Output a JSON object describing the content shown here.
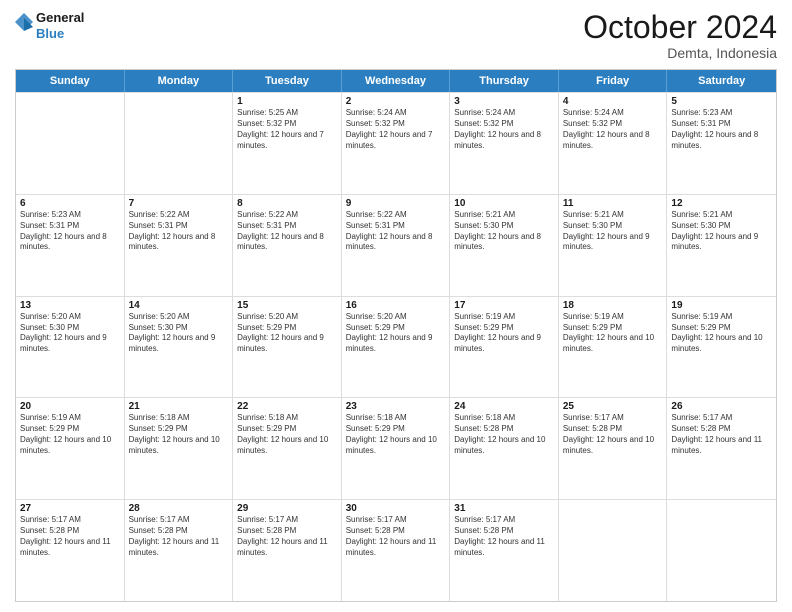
{
  "header": {
    "logo_line1": "General",
    "logo_line2": "Blue",
    "month_title": "October 2024",
    "location": "Demta, Indonesia"
  },
  "days_of_week": [
    "Sunday",
    "Monday",
    "Tuesday",
    "Wednesday",
    "Thursday",
    "Friday",
    "Saturday"
  ],
  "weeks": [
    [
      {
        "day": "",
        "sunrise": "",
        "sunset": "",
        "daylight": ""
      },
      {
        "day": "",
        "sunrise": "",
        "sunset": "",
        "daylight": ""
      },
      {
        "day": "1",
        "sunrise": "Sunrise: 5:25 AM",
        "sunset": "Sunset: 5:32 PM",
        "daylight": "Daylight: 12 hours and 7 minutes."
      },
      {
        "day": "2",
        "sunrise": "Sunrise: 5:24 AM",
        "sunset": "Sunset: 5:32 PM",
        "daylight": "Daylight: 12 hours and 7 minutes."
      },
      {
        "day": "3",
        "sunrise": "Sunrise: 5:24 AM",
        "sunset": "Sunset: 5:32 PM",
        "daylight": "Daylight: 12 hours and 8 minutes."
      },
      {
        "day": "4",
        "sunrise": "Sunrise: 5:24 AM",
        "sunset": "Sunset: 5:32 PM",
        "daylight": "Daylight: 12 hours and 8 minutes."
      },
      {
        "day": "5",
        "sunrise": "Sunrise: 5:23 AM",
        "sunset": "Sunset: 5:31 PM",
        "daylight": "Daylight: 12 hours and 8 minutes."
      }
    ],
    [
      {
        "day": "6",
        "sunrise": "Sunrise: 5:23 AM",
        "sunset": "Sunset: 5:31 PM",
        "daylight": "Daylight: 12 hours and 8 minutes."
      },
      {
        "day": "7",
        "sunrise": "Sunrise: 5:22 AM",
        "sunset": "Sunset: 5:31 PM",
        "daylight": "Daylight: 12 hours and 8 minutes."
      },
      {
        "day": "8",
        "sunrise": "Sunrise: 5:22 AM",
        "sunset": "Sunset: 5:31 PM",
        "daylight": "Daylight: 12 hours and 8 minutes."
      },
      {
        "day": "9",
        "sunrise": "Sunrise: 5:22 AM",
        "sunset": "Sunset: 5:31 PM",
        "daylight": "Daylight: 12 hours and 8 minutes."
      },
      {
        "day": "10",
        "sunrise": "Sunrise: 5:21 AM",
        "sunset": "Sunset: 5:30 PM",
        "daylight": "Daylight: 12 hours and 8 minutes."
      },
      {
        "day": "11",
        "sunrise": "Sunrise: 5:21 AM",
        "sunset": "Sunset: 5:30 PM",
        "daylight": "Daylight: 12 hours and 9 minutes."
      },
      {
        "day": "12",
        "sunrise": "Sunrise: 5:21 AM",
        "sunset": "Sunset: 5:30 PM",
        "daylight": "Daylight: 12 hours and 9 minutes."
      }
    ],
    [
      {
        "day": "13",
        "sunrise": "Sunrise: 5:20 AM",
        "sunset": "Sunset: 5:30 PM",
        "daylight": "Daylight: 12 hours and 9 minutes."
      },
      {
        "day": "14",
        "sunrise": "Sunrise: 5:20 AM",
        "sunset": "Sunset: 5:30 PM",
        "daylight": "Daylight: 12 hours and 9 minutes."
      },
      {
        "day": "15",
        "sunrise": "Sunrise: 5:20 AM",
        "sunset": "Sunset: 5:29 PM",
        "daylight": "Daylight: 12 hours and 9 minutes."
      },
      {
        "day": "16",
        "sunrise": "Sunrise: 5:20 AM",
        "sunset": "Sunset: 5:29 PM",
        "daylight": "Daylight: 12 hours and 9 minutes."
      },
      {
        "day": "17",
        "sunrise": "Sunrise: 5:19 AM",
        "sunset": "Sunset: 5:29 PM",
        "daylight": "Daylight: 12 hours and 9 minutes."
      },
      {
        "day": "18",
        "sunrise": "Sunrise: 5:19 AM",
        "sunset": "Sunset: 5:29 PM",
        "daylight": "Daylight: 12 hours and 10 minutes."
      },
      {
        "day": "19",
        "sunrise": "Sunrise: 5:19 AM",
        "sunset": "Sunset: 5:29 PM",
        "daylight": "Daylight: 12 hours and 10 minutes."
      }
    ],
    [
      {
        "day": "20",
        "sunrise": "Sunrise: 5:19 AM",
        "sunset": "Sunset: 5:29 PM",
        "daylight": "Daylight: 12 hours and 10 minutes."
      },
      {
        "day": "21",
        "sunrise": "Sunrise: 5:18 AM",
        "sunset": "Sunset: 5:29 PM",
        "daylight": "Daylight: 12 hours and 10 minutes."
      },
      {
        "day": "22",
        "sunrise": "Sunrise: 5:18 AM",
        "sunset": "Sunset: 5:29 PM",
        "daylight": "Daylight: 12 hours and 10 minutes."
      },
      {
        "day": "23",
        "sunrise": "Sunrise: 5:18 AM",
        "sunset": "Sunset: 5:29 PM",
        "daylight": "Daylight: 12 hours and 10 minutes."
      },
      {
        "day": "24",
        "sunrise": "Sunrise: 5:18 AM",
        "sunset": "Sunset: 5:28 PM",
        "daylight": "Daylight: 12 hours and 10 minutes."
      },
      {
        "day": "25",
        "sunrise": "Sunrise: 5:17 AM",
        "sunset": "Sunset: 5:28 PM",
        "daylight": "Daylight: 12 hours and 10 minutes."
      },
      {
        "day": "26",
        "sunrise": "Sunrise: 5:17 AM",
        "sunset": "Sunset: 5:28 PM",
        "daylight": "Daylight: 12 hours and 11 minutes."
      }
    ],
    [
      {
        "day": "27",
        "sunrise": "Sunrise: 5:17 AM",
        "sunset": "Sunset: 5:28 PM",
        "daylight": "Daylight: 12 hours and 11 minutes."
      },
      {
        "day": "28",
        "sunrise": "Sunrise: 5:17 AM",
        "sunset": "Sunset: 5:28 PM",
        "daylight": "Daylight: 12 hours and 11 minutes."
      },
      {
        "day": "29",
        "sunrise": "Sunrise: 5:17 AM",
        "sunset": "Sunset: 5:28 PM",
        "daylight": "Daylight: 12 hours and 11 minutes."
      },
      {
        "day": "30",
        "sunrise": "Sunrise: 5:17 AM",
        "sunset": "Sunset: 5:28 PM",
        "daylight": "Daylight: 12 hours and 11 minutes."
      },
      {
        "day": "31",
        "sunrise": "Sunrise: 5:17 AM",
        "sunset": "Sunset: 5:28 PM",
        "daylight": "Daylight: 12 hours and 11 minutes."
      },
      {
        "day": "",
        "sunrise": "",
        "sunset": "",
        "daylight": ""
      },
      {
        "day": "",
        "sunrise": "",
        "sunset": "",
        "daylight": ""
      }
    ]
  ]
}
